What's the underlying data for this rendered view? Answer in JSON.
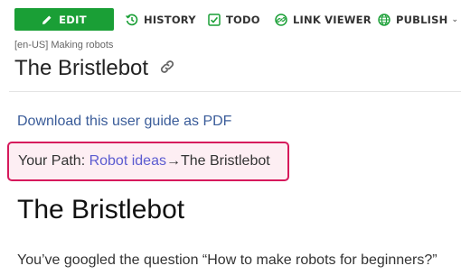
{
  "toolbar": {
    "edit_label": "EDIT",
    "history_label": "HISTORY",
    "todo_label": "TODO",
    "link_viewer_label": "LINK VIEWER",
    "publish_label": "PUBLISH",
    "publish_caret": "⌄",
    "edit_color": "#1a9f36",
    "icon_color": "#1a9f36"
  },
  "header": {
    "breadcrumb": "[en-US] Making robots",
    "page_title": "The Bristlebot",
    "title_icon": "link-icon"
  },
  "content": {
    "pdf_link": "Download this user guide as PDF",
    "path": {
      "prefix": "Your Path: ",
      "link": "Robot ideas",
      "arrow": "→",
      "current": "The Bristlebot",
      "border_color": "#d6195c"
    },
    "heading": "The Bristlebot",
    "intro": "You’ve googled the question “How to make robots for beginners?”"
  }
}
